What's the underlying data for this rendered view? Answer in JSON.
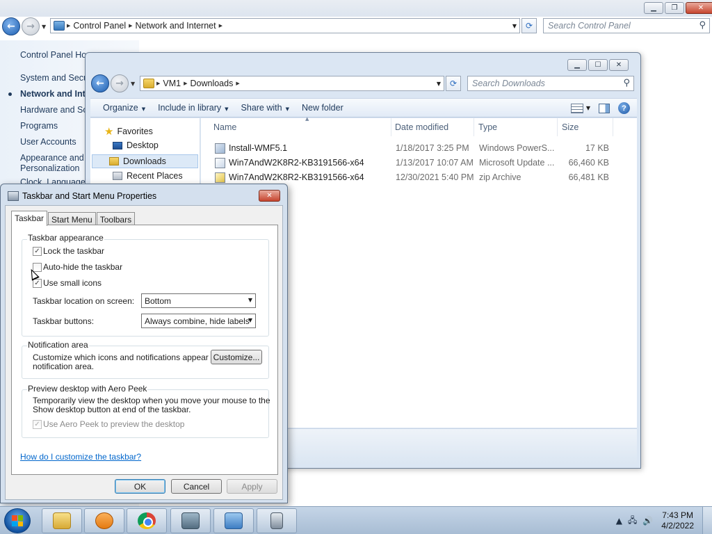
{
  "control_panel": {
    "breadcrumb": [
      "Control Panel",
      "Network and Internet"
    ],
    "search_placeholder": "Search Control Panel",
    "left_nav": [
      "Control Panel Hor",
      "System and Secur",
      "Network and Inte",
      "Hardware and Sou",
      "Programs",
      "User Accounts",
      "Appearance and",
      "Personalization",
      "Clock, Language"
    ]
  },
  "explorer": {
    "breadcrumb": [
      "VM1",
      "Downloads"
    ],
    "search_placeholder": "Search Downloads",
    "commands": [
      "Organize",
      "Include in library",
      "Share with",
      "New folder"
    ],
    "nav": [
      "Favorites",
      "Desktop",
      "Downloads",
      "Recent Places"
    ],
    "columns": [
      "Name",
      "Date modified",
      "Type",
      "Size"
    ],
    "files": [
      {
        "name": "Install-WMF5.1",
        "date": "1/18/2017 3:25 PM",
        "type": "Windows PowerS...",
        "size": "17 KB",
        "icon": "powershell-file-icon"
      },
      {
        "name": "Win7AndW2K8R2-KB3191566-x64",
        "date": "1/13/2017 10:07 AM",
        "type": "Microsoft Update ...",
        "size": "66,460 KB",
        "icon": "msu-file-icon"
      },
      {
        "name": "Win7AndW2K8R2-KB3191566-x64",
        "date": "12/30/2021 5:40 PM",
        "type": "zip Archive",
        "size": "66,481 KB",
        "icon": "zip-file-icon"
      }
    ]
  },
  "dialog": {
    "title": "Taskbar and Start Menu Properties",
    "tabs": [
      "Taskbar",
      "Start Menu",
      "Toolbars"
    ],
    "appearance_label": "Taskbar appearance",
    "lock_label": "Lock the taskbar",
    "lock_checked": true,
    "autohide_label": "Auto-hide the taskbar",
    "autohide_checked": false,
    "smallicons_label": "Use small icons",
    "smallicons_checked": true,
    "location_label": "Taskbar location on screen:",
    "location_value": "Bottom",
    "buttons_label": "Taskbar buttons:",
    "buttons_value": "Always combine, hide labels",
    "notification_label": "Notification area",
    "notification_text_1": "Customize which icons and notifications appear in the",
    "notification_text_2": "notification area.",
    "customize_button": "Customize...",
    "aero_label": "Preview desktop with Aero Peek",
    "aero_text_1": "Temporarily view the desktop when you move your mouse to the",
    "aero_text_2": "Show desktop button at end of the taskbar.",
    "aero_check_label": "Use Aero Peek to preview the desktop",
    "aero_checked": true,
    "help_link": "How do I customize the taskbar?",
    "ok": "OK",
    "cancel": "Cancel",
    "apply": "Apply"
  },
  "taskbar": {
    "apps": [
      "windows-explorer-icon",
      "media-player-icon",
      "chrome-icon",
      "system-monitor-icon",
      "control-panel-icon",
      "taskbar-properties-icon"
    ],
    "time": "7:43 PM",
    "date": "4/2/2022"
  }
}
